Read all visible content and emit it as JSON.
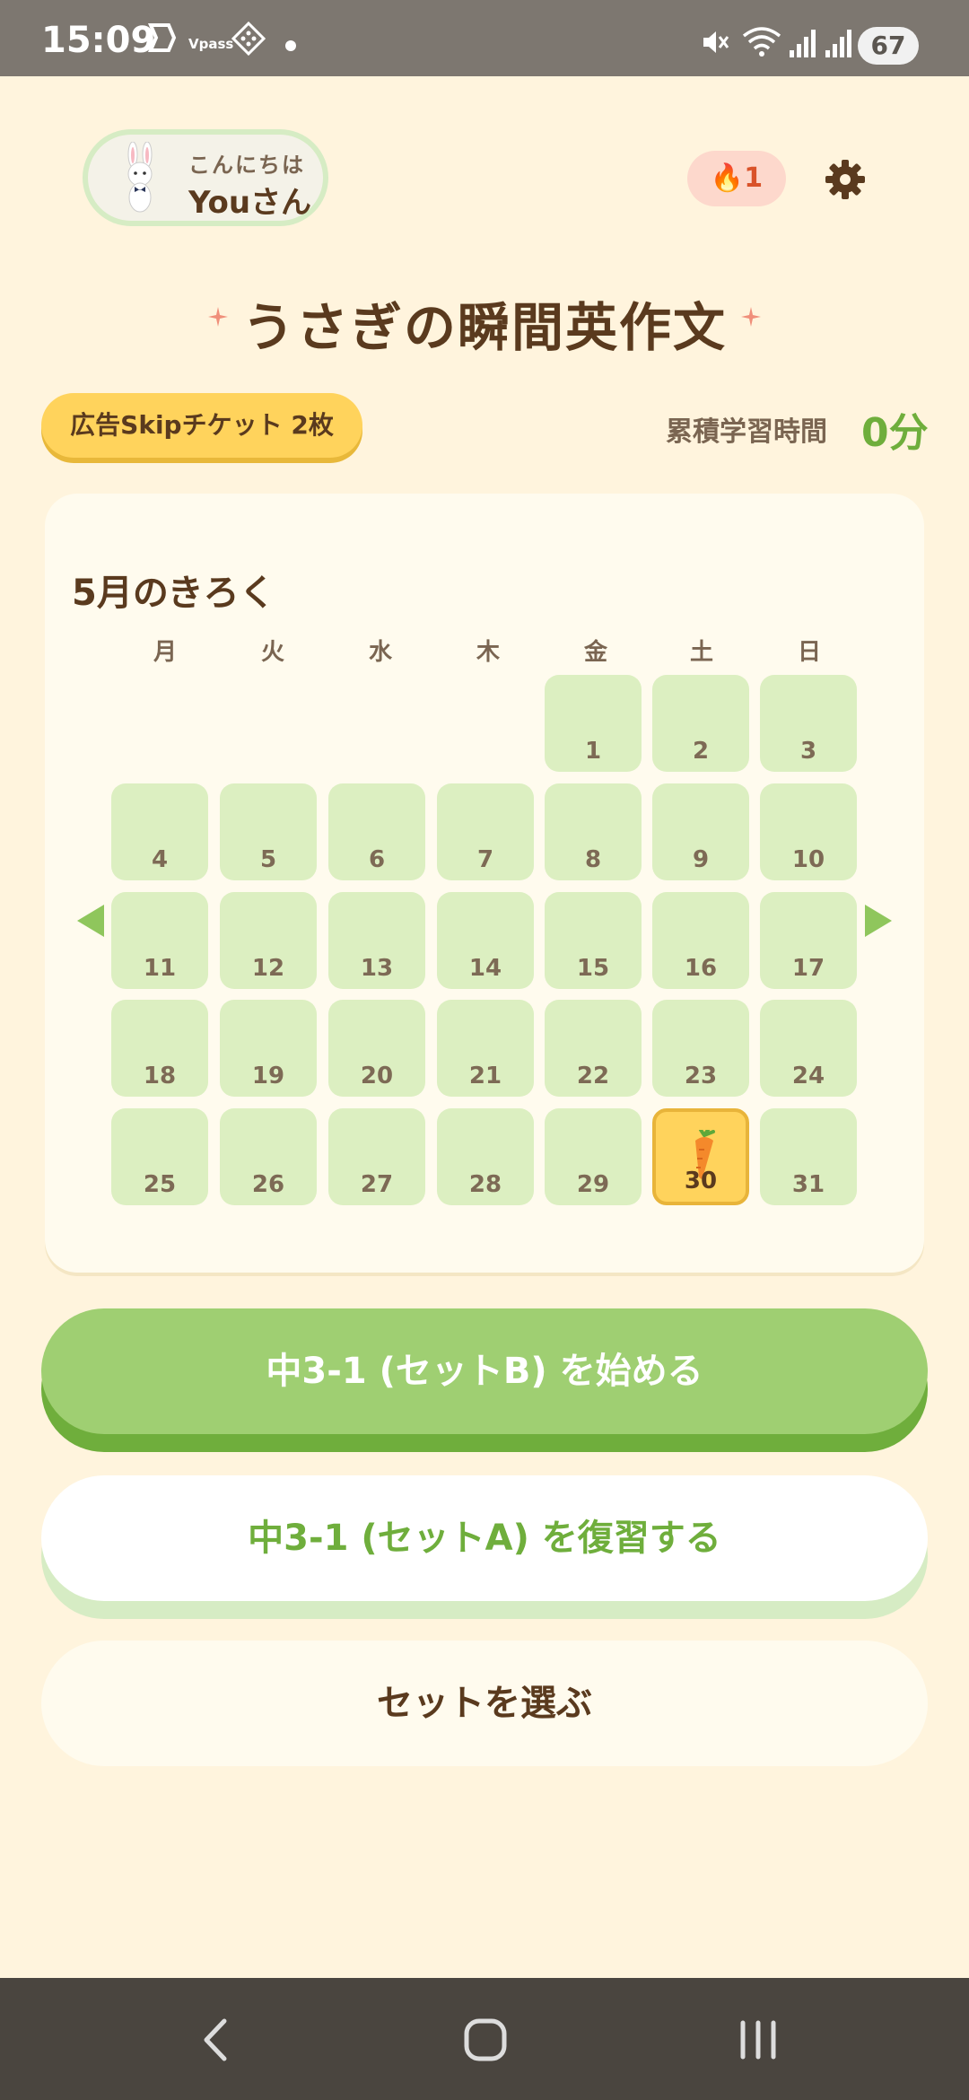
{
  "status_bar": {
    "time": "15:09",
    "app_label": "Vpass",
    "battery": "67",
    "icons": [
      "app-s-icon",
      "vpass-icon",
      "diamond-grid-icon",
      "dot-icon",
      "mute-icon",
      "wifi-icon",
      "signal-icon",
      "signal-icon-2",
      "battery-icon"
    ]
  },
  "header": {
    "greeting": "こんにちは",
    "user_name": "Youさん",
    "streak": "🔥1",
    "settings_icon": "gear-icon"
  },
  "title": "うさぎの瞬間英作文",
  "ticket": "広告Skipチケット 2枚",
  "study_time": {
    "label": "累積学習時間",
    "value": "0分"
  },
  "calendar": {
    "title": "5月のきろく",
    "weekdays": [
      "月",
      "火",
      "水",
      "木",
      "金",
      "土",
      "日"
    ],
    "days": [
      "1",
      "2",
      "3",
      "4",
      "5",
      "6",
      "7",
      "8",
      "9",
      "10",
      "11",
      "12",
      "13",
      "14",
      "15",
      "16",
      "17",
      "18",
      "19",
      "20",
      "21",
      "22",
      "23",
      "24",
      "25",
      "26",
      "27",
      "28",
      "29",
      "30",
      "31"
    ],
    "today": "30",
    "today_icon": "carrot-icon"
  },
  "buttons": {
    "start": "中3-1 (セットB) を始める",
    "review": "中3-1 (セットA) を復習する",
    "select": "セットを選ぶ"
  },
  "colors": {
    "background": "#fff4dd",
    "accent_green": "#9fcf72",
    "accent_yellow": "#ffd35c",
    "text_brown": "#5a3a1e"
  }
}
